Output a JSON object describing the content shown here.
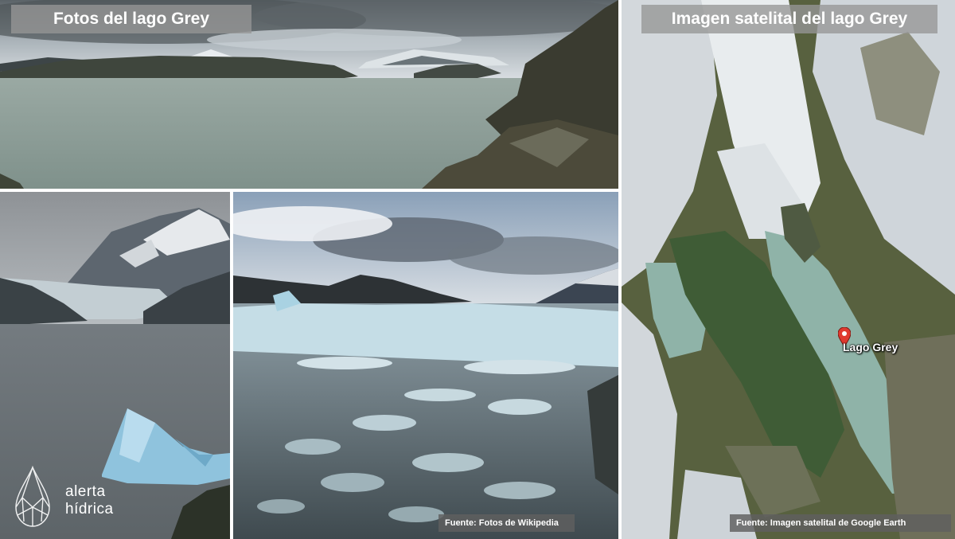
{
  "titles": {
    "photos": "Fotos del lago Grey",
    "satellite": "Imagen satelital del lago Grey"
  },
  "captions": {
    "photos_source": "Fuente: Fotos de Wikipedia",
    "satellite_source": "Fuente: Imagen satelital de Google Earth"
  },
  "map": {
    "pin_label": "Lago Grey",
    "pin_icon": "map-pin-icon",
    "pin_color": "#e03a2f"
  },
  "logo": {
    "brand": "alerta",
    "brand_line2": "hídrica",
    "icon": "water-drop-icon"
  },
  "colors": {
    "lake_water": "#8fb3a8",
    "title_bar": "#969696",
    "caption_bar": "#5f5f5f"
  }
}
